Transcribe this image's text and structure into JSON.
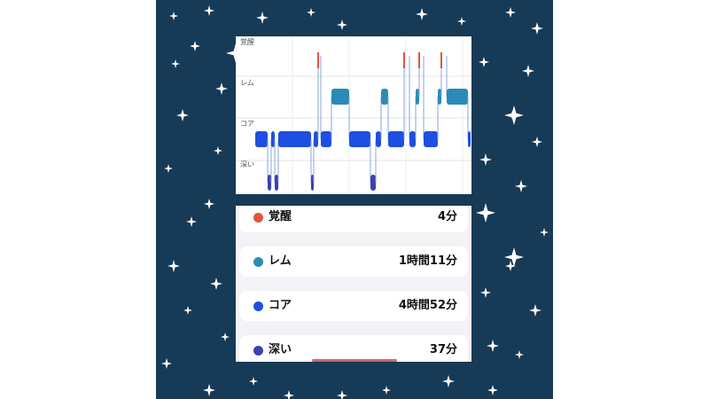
{
  "chart": {
    "stage_labels": [
      "覚醒",
      "レム",
      "コア",
      "深い"
    ],
    "stage_colors": [
      "#e0553a",
      "#2a8bb8",
      "#1e4fe0",
      "#3f3fb0"
    ],
    "segments": [
      {
        "stage": "コア"
      },
      {
        "stage": "深い"
      },
      {
        "stage": "コア"
      },
      {
        "stage": "深い"
      },
      {
        "stage": "コア"
      },
      {
        "stage": "深い"
      },
      {
        "stage": "コア"
      },
      {
        "stage": "覚醒"
      },
      {
        "stage": "コア"
      },
      {
        "stage": "レム"
      },
      {
        "stage": "コア"
      },
      {
        "stage": "深い"
      },
      {
        "stage": "コア"
      },
      {
        "stage": "レム"
      },
      {
        "stage": "コア"
      },
      {
        "stage": "覚醒"
      },
      {
        "stage": "コア"
      },
      {
        "stage": "レム"
      },
      {
        "stage": "覚醒"
      },
      {
        "stage": "コア"
      },
      {
        "stage": "レム"
      },
      {
        "stage": "覚醒"
      },
      {
        "stage": "レム"
      },
      {
        "stage": "コア"
      }
    ]
  },
  "summary": [
    {
      "label": "覚醒",
      "value": "4分",
      "color": "#e0553a"
    },
    {
      "label": "レム",
      "value": "1時間11分",
      "color": "#2a8bb8"
    },
    {
      "label": "コア",
      "value": "4時間52分",
      "color": "#1e4fe0"
    },
    {
      "label": "深い",
      "value": "37分",
      "color": "#3f3fb0"
    }
  ]
}
